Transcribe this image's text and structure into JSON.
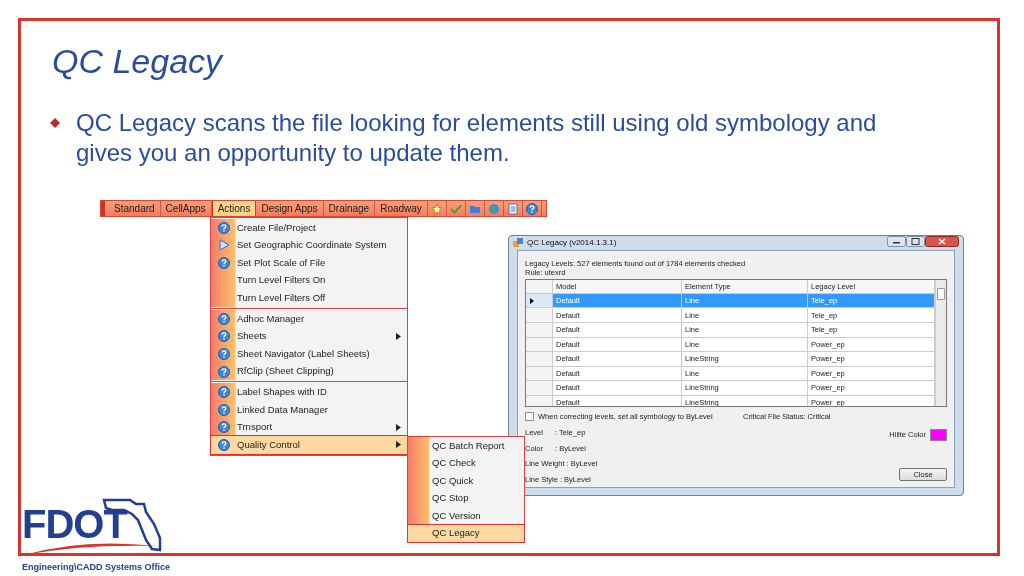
{
  "slide": {
    "title": "QC Legacy",
    "bullets": [
      "QC Legacy scans the file looking for elements still using old symbology and gives you an opportunity to update them."
    ]
  },
  "toolbar": {
    "items": [
      {
        "label": "Standard",
        "selected": false
      },
      {
        "label": "CellApps",
        "selected": false
      },
      {
        "label": "Actions",
        "selected": true
      },
      {
        "label": "Design Apps",
        "selected": false
      },
      {
        "label": "Drainage",
        "selected": false
      },
      {
        "label": "Roadway",
        "selected": false
      }
    ]
  },
  "menu": {
    "groups": [
      [
        {
          "label": "Create File/Project",
          "kind": "help",
          "submenu": false,
          "selected": false
        },
        {
          "label": "Set Geographic Coordinate System",
          "kind": "play",
          "submenu": false,
          "selected": false
        },
        {
          "label": "Set Plot Scale of File",
          "kind": "help",
          "submenu": false,
          "selected": false
        },
        {
          "label": "Turn Level Filters On",
          "kind": "plain",
          "submenu": false,
          "selected": false
        },
        {
          "label": "Turn Level Filters Off",
          "kind": "plain",
          "submenu": false,
          "selected": false
        }
      ],
      [
        {
          "label": "Adhoc Manager",
          "kind": "help",
          "submenu": false,
          "selected": false
        },
        {
          "label": "Sheets",
          "kind": "help",
          "submenu": true,
          "selected": false
        },
        {
          "label": "Sheet Navigator (Label Sheets)",
          "kind": "help",
          "submenu": false,
          "selected": false
        },
        {
          "label": "RfClip (Sheet Clipping)",
          "kind": "help",
          "submenu": false,
          "selected": false
        }
      ],
      [
        {
          "label": "Label Shapes with ID",
          "kind": "help",
          "submenu": false,
          "selected": false
        },
        {
          "label": "Linked Data Manager",
          "kind": "help",
          "submenu": false,
          "selected": false
        },
        {
          "label": "Trnsport",
          "kind": "help",
          "submenu": true,
          "selected": false
        },
        {
          "label": "Quality Control",
          "kind": "help",
          "submenu": true,
          "selected": true
        }
      ]
    ]
  },
  "submenu": {
    "items": [
      {
        "label": "QC Batch Report",
        "selected": false
      },
      {
        "label": "QC Check",
        "selected": false
      },
      {
        "label": "QC Quick",
        "selected": false
      },
      {
        "label": "QC Stop",
        "selected": false
      },
      {
        "label": "QC Version",
        "selected": false
      },
      {
        "label": "QC Legacy",
        "selected": true
      }
    ]
  },
  "dialog": {
    "title": "QC Legacy (v2014.1.3.1)",
    "summary": "Legacy Levels: 527 elements found out of 1784 elements checked",
    "rule": "Rule: utexrd",
    "columns": [
      "Model",
      "Element Type",
      "Legacy Level"
    ],
    "rows": [
      {
        "cells": [
          "Default",
          "Line",
          "Tele_ep"
        ],
        "selected": true
      },
      {
        "cells": [
          "Default",
          "Line",
          "Tele_ep"
        ],
        "selected": false
      },
      {
        "cells": [
          "Default",
          "Line",
          "Tele_ep"
        ],
        "selected": false
      },
      {
        "cells": [
          "Default",
          "Line",
          "Power_ep"
        ],
        "selected": false
      },
      {
        "cells": [
          "Default",
          "LineString",
          "Power_ep"
        ],
        "selected": false
      },
      {
        "cells": [
          "Default",
          "Line",
          "Power_ep"
        ],
        "selected": false
      },
      {
        "cells": [
          "Default",
          "LineString",
          "Power_ep"
        ],
        "selected": false
      },
      {
        "cells": [
          "Default",
          "LineString",
          "Power_ep"
        ],
        "selected": false
      }
    ],
    "checkbox": {
      "label": "When correcting levels, set all symbology to ByLevel",
      "checked": false
    },
    "status": "Critical File Status: Critical",
    "properties": [
      {
        "label": "Level",
        "value": ": Tele_ep"
      },
      {
        "label": "Color",
        "value": ": ByLevel"
      },
      {
        "label": "Line Weight",
        "value": ": ByLevel"
      },
      {
        "label": "Line Style",
        "value": ": ByLevel"
      }
    ],
    "hilite": {
      "label": "Hilite Color",
      "color": "#ff00ff"
    },
    "close": "Close"
  },
  "footer": {
    "logo": "FDOT",
    "office": "Engineering\\CADD Systems Office"
  }
}
